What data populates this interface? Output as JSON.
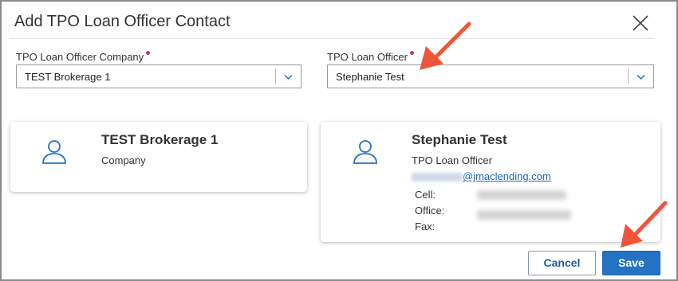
{
  "dialog": {
    "title": "Add TPO Loan Officer Contact"
  },
  "fields": {
    "company": {
      "label": "TPO Loan Officer Company",
      "value": "TEST Brokerage 1"
    },
    "officer": {
      "label": "TPO Loan Officer",
      "value": "Stephanie Test"
    }
  },
  "company_card": {
    "name": "TEST Brokerage 1",
    "role": "Company"
  },
  "officer_card": {
    "name": "Stephanie Test",
    "role": "TPO Loan Officer",
    "email_domain": "@jmaclending.com",
    "cell_label": "Cell:",
    "office_label": "Office:",
    "fax_label": "Fax:"
  },
  "buttons": {
    "cancel": "Cancel",
    "save": "Save"
  },
  "colors": {
    "primary": "#2372c4",
    "required": "#c8374b",
    "annotation_arrow": "#f0553a"
  }
}
